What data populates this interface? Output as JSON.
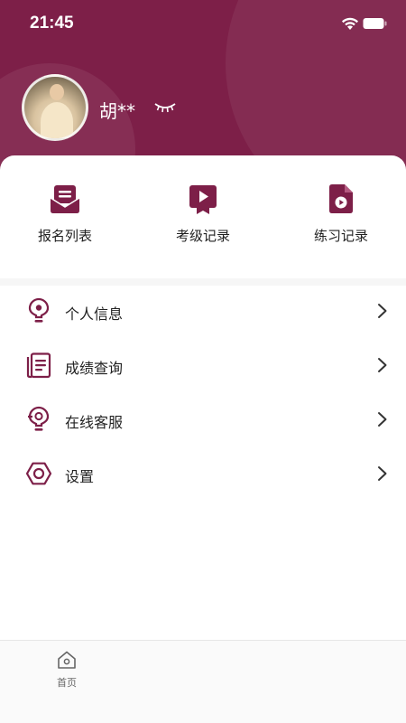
{
  "status_bar": {
    "time": "21:45"
  },
  "profile": {
    "name": "胡**"
  },
  "quick_actions": [
    {
      "label": "报名列表",
      "icon": "envelope-list-icon"
    },
    {
      "label": "考级记录",
      "icon": "video-badge-icon"
    },
    {
      "label": "练习记录",
      "icon": "video-file-icon"
    }
  ],
  "menu": [
    {
      "label": "个人信息",
      "icon": "person-pin-icon"
    },
    {
      "label": "成绩查询",
      "icon": "document-list-icon"
    },
    {
      "label": "在线客服",
      "icon": "headset-icon"
    },
    {
      "label": "设置",
      "icon": "settings-hexagon-icon"
    }
  ],
  "tabbar": {
    "home_label": "首页"
  },
  "colors": {
    "brand": "#7d1f48"
  }
}
